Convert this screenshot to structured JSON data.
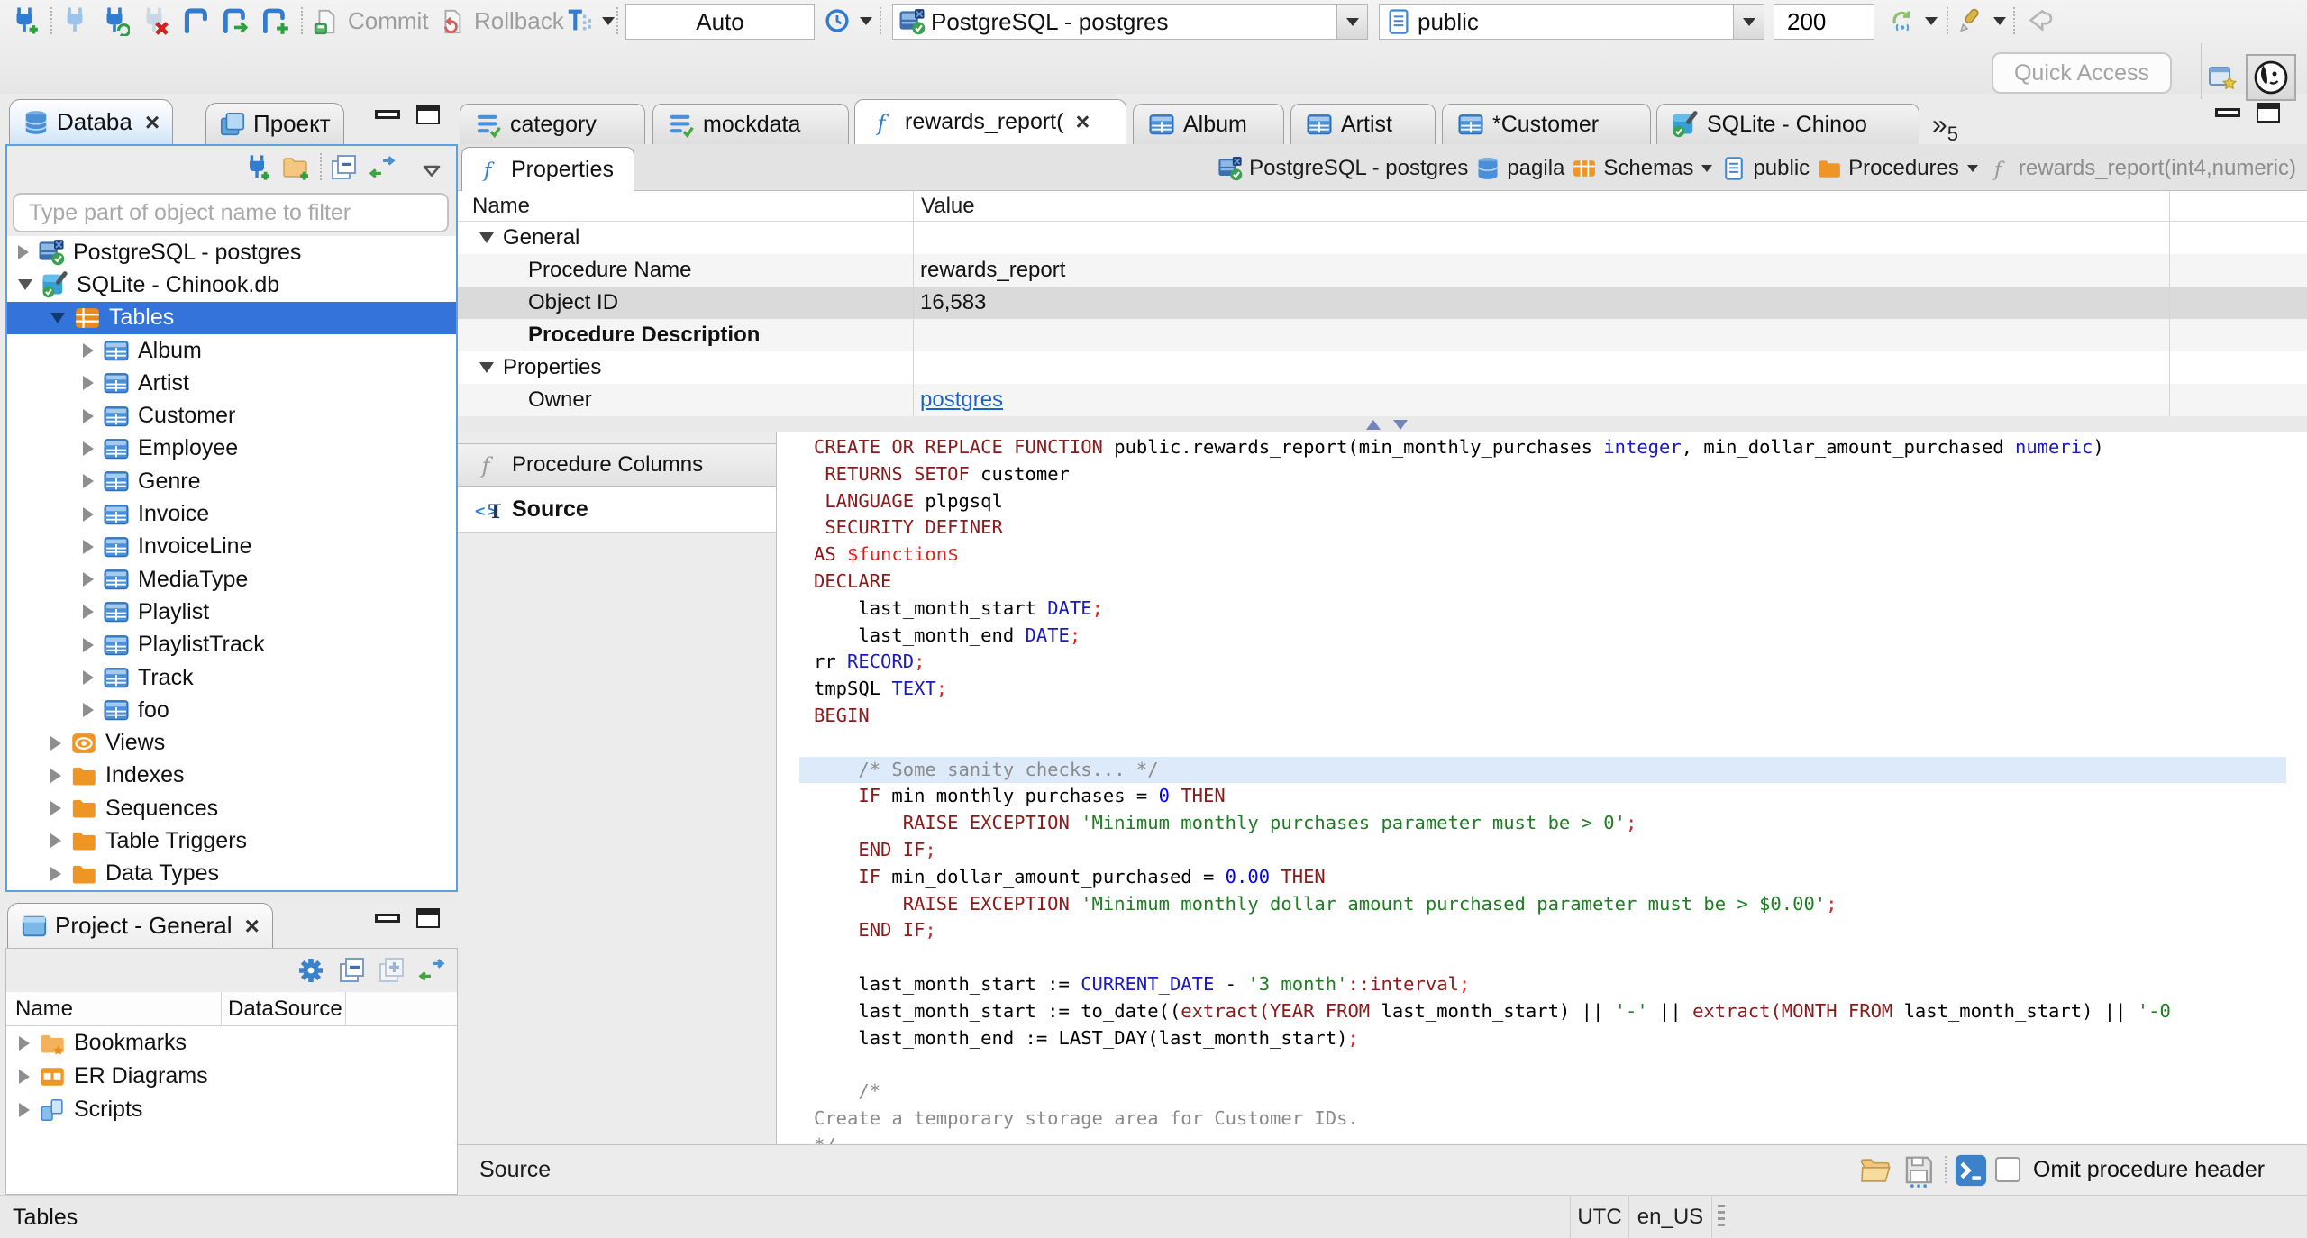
{
  "main_toolbar": {
    "commit": "Commit",
    "rollback": "Rollback",
    "tx_mode": "Auto",
    "connection": "PostgreSQL - postgres",
    "schema": "public",
    "fetch_size": "200",
    "quick_access": "Quick Access"
  },
  "navigator": {
    "tab_database": "Databa",
    "tab_project": "Проект",
    "filter_placeholder": "Type part of object name to filter",
    "tree": [
      {
        "label": "PostgreSQL - postgres",
        "icon": "postgres-db",
        "level": 0,
        "state": "collapsed"
      },
      {
        "label": "SQLite - Chinook.db",
        "icon": "sqlite-db",
        "level": 0,
        "state": "expanded"
      },
      {
        "label": "Tables",
        "icon": "tables",
        "level": 1,
        "state": "expanded",
        "selected": true
      },
      {
        "label": "Album",
        "icon": "table",
        "level": 2,
        "state": "collapsed"
      },
      {
        "label": "Artist",
        "icon": "table",
        "level": 2,
        "state": "collapsed"
      },
      {
        "label": "Customer",
        "icon": "table",
        "level": 2,
        "state": "collapsed"
      },
      {
        "label": "Employee",
        "icon": "table",
        "level": 2,
        "state": "collapsed"
      },
      {
        "label": "Genre",
        "icon": "table",
        "level": 2,
        "state": "collapsed"
      },
      {
        "label": "Invoice",
        "icon": "table",
        "level": 2,
        "state": "collapsed"
      },
      {
        "label": "InvoiceLine",
        "icon": "table",
        "level": 2,
        "state": "collapsed"
      },
      {
        "label": "MediaType",
        "icon": "table",
        "level": 2,
        "state": "collapsed"
      },
      {
        "label": "Playlist",
        "icon": "table",
        "level": 2,
        "state": "collapsed"
      },
      {
        "label": "PlaylistTrack",
        "icon": "table",
        "level": 2,
        "state": "collapsed"
      },
      {
        "label": "Track",
        "icon": "table",
        "level": 2,
        "state": "collapsed"
      },
      {
        "label": "foo",
        "icon": "table",
        "level": 2,
        "state": "collapsed"
      },
      {
        "label": "Views",
        "icon": "views",
        "level": 1,
        "state": "collapsed"
      },
      {
        "label": "Indexes",
        "icon": "folder",
        "level": 1,
        "state": "collapsed"
      },
      {
        "label": "Sequences",
        "icon": "folder",
        "level": 1,
        "state": "collapsed"
      },
      {
        "label": "Table Triggers",
        "icon": "folder",
        "level": 1,
        "state": "collapsed"
      },
      {
        "label": "Data Types",
        "icon": "folder",
        "level": 1,
        "state": "collapsed"
      }
    ]
  },
  "project_panel": {
    "title": "Project - General",
    "col_name": "Name",
    "col_datasource": "DataSource",
    "items": [
      {
        "label": "Bookmarks",
        "icon": "bookmarks"
      },
      {
        "label": "ER Diagrams",
        "icon": "er-diagrams"
      },
      {
        "label": "Scripts",
        "icon": "scripts"
      }
    ]
  },
  "editor": {
    "tabs": [
      {
        "label": "category",
        "icon": "sql-script"
      },
      {
        "label": "mockdata",
        "icon": "sql-script"
      },
      {
        "label": "rewards_report(",
        "icon": "function",
        "active": true,
        "closable": true
      },
      {
        "label": "Album",
        "icon": "table"
      },
      {
        "label": "Artist",
        "icon": "table"
      },
      {
        "label": "*Customer",
        "icon": "table"
      },
      {
        "label": "SQLite - Chinoo",
        "icon": "sqlite-db"
      }
    ],
    "overflow_chevron": "»",
    "overflow_count": "5",
    "properties_tab": "Properties",
    "breadcrumb": [
      {
        "label": "PostgreSQL - postgres",
        "icon": "postgres-db"
      },
      {
        "label": "pagila",
        "icon": "database"
      },
      {
        "label": "Schemas",
        "icon": "schemas",
        "dropdown": true
      },
      {
        "label": "public",
        "icon": "schema"
      },
      {
        "label": "Procedures",
        "icon": "folder",
        "dropdown": true
      },
      {
        "label": "rewards_report(int4,numeric)",
        "icon": "function-gray",
        "muted": true
      }
    ],
    "grid": {
      "col_name": "Name",
      "col_value": "Value",
      "rows": [
        {
          "name": "General",
          "kind": "group"
        },
        {
          "name": "Procedure Name",
          "kind": "item",
          "value": "rewards_report"
        },
        {
          "name": "Object ID",
          "kind": "item",
          "value": "16,583",
          "selected": true
        },
        {
          "name": "Procedure Description",
          "kind": "item",
          "value": "",
          "bold": true
        },
        {
          "name": "Properties",
          "kind": "group"
        },
        {
          "name": "Owner",
          "kind": "item",
          "value": "postgres",
          "link": true
        }
      ]
    },
    "side_tabs": [
      {
        "label": "Procedure Columns",
        "icon": "function-gray"
      },
      {
        "label": "Source",
        "icon": "source",
        "active": true
      }
    ],
    "bottom_bar": {
      "label": "Source",
      "omit_label": "Omit procedure header"
    }
  },
  "source_code": {
    "lines": [
      {
        "seg": [
          [
            "CREATE OR REPLACE FUNCTION",
            "k"
          ],
          [
            " public.rewards_report(min_monthly_purchases ",
            "p"
          ],
          [
            "integer",
            "t"
          ],
          [
            ", min_dollar_amount_purchased ",
            "p"
          ],
          [
            "numeric",
            "t"
          ],
          [
            ")",
            "p"
          ]
        ]
      },
      {
        "seg": [
          [
            " RETURNS SETOF",
            "k"
          ],
          [
            " customer",
            "p"
          ]
        ]
      },
      {
        "seg": [
          [
            " LANGUAGE",
            "k"
          ],
          [
            " plpgsql",
            "p"
          ]
        ]
      },
      {
        "seg": [
          [
            " SECURITY DEFINER",
            "k"
          ]
        ]
      },
      {
        "seg": [
          [
            "AS",
            "k"
          ],
          [
            " ",
            "p"
          ],
          [
            "$function$",
            "r"
          ]
        ]
      },
      {
        "seg": [
          [
            "DECLARE",
            "k"
          ]
        ]
      },
      {
        "seg": [
          [
            "    last_month_start ",
            "p"
          ],
          [
            "DATE",
            "t"
          ],
          [
            ";",
            "r"
          ]
        ]
      },
      {
        "seg": [
          [
            "    last_month_end ",
            "p"
          ],
          [
            "DATE",
            "t"
          ],
          [
            ";",
            "r"
          ]
        ]
      },
      {
        "seg": [
          [
            "rr ",
            "p"
          ],
          [
            "RECORD",
            "t"
          ],
          [
            ";",
            "r"
          ]
        ]
      },
      {
        "seg": [
          [
            "tmpSQL ",
            "p"
          ],
          [
            "TEXT",
            "t"
          ],
          [
            ";",
            "r"
          ]
        ]
      },
      {
        "seg": [
          [
            "BEGIN",
            "k"
          ]
        ]
      },
      {
        "seg": []
      },
      {
        "hl": true,
        "seg": [
          [
            "    /* Some sanity checks... */",
            "c"
          ]
        ]
      },
      {
        "seg": [
          [
            "    IF",
            "k"
          ],
          [
            " min_monthly_purchases = ",
            "p"
          ],
          [
            "0",
            "n"
          ],
          [
            " ",
            "p"
          ],
          [
            "THEN",
            "k"
          ]
        ]
      },
      {
        "seg": [
          [
            "        RAISE EXCEPTION",
            "k"
          ],
          [
            " ",
            "p"
          ],
          [
            "'Minimum monthly purchases parameter must be > 0'",
            "s"
          ],
          [
            ";",
            "r"
          ]
        ]
      },
      {
        "seg": [
          [
            "    END IF",
            "k"
          ],
          [
            ";",
            "r"
          ]
        ]
      },
      {
        "seg": [
          [
            "    IF",
            "k"
          ],
          [
            " min_dollar_amount_purchased = ",
            "p"
          ],
          [
            "0.00",
            "n"
          ],
          [
            " ",
            "p"
          ],
          [
            "THEN",
            "k"
          ]
        ]
      },
      {
        "seg": [
          [
            "        RAISE EXCEPTION",
            "k"
          ],
          [
            " ",
            "p"
          ],
          [
            "'Minimum monthly dollar amount purchased parameter must be > $0.00'",
            "s"
          ],
          [
            ";",
            "r"
          ]
        ]
      },
      {
        "seg": [
          [
            "    END IF",
            "k"
          ],
          [
            ";",
            "r"
          ]
        ]
      },
      {
        "seg": []
      },
      {
        "seg": [
          [
            "    last_month_start := ",
            "p"
          ],
          [
            "CURRENT_DATE",
            "t"
          ],
          [
            " - ",
            "p"
          ],
          [
            "'3 month'",
            "s"
          ],
          [
            "::interval",
            "k"
          ],
          [
            ";",
            "r"
          ]
        ]
      },
      {
        "seg": [
          [
            "    last_month_start := to_date((",
            "p"
          ],
          [
            "extract(",
            "k"
          ],
          [
            "YEAR FROM",
            "k"
          ],
          [
            " last_month_start) || ",
            "p"
          ],
          [
            "'-'",
            "s"
          ],
          [
            " || ",
            "p"
          ],
          [
            "extract(",
            "k"
          ],
          [
            "MONTH FROM",
            "k"
          ],
          [
            " last_month_start) || ",
            "p"
          ],
          [
            "'-0",
            "s"
          ]
        ]
      },
      {
        "seg": [
          [
            "    last_month_end := LAST_DAY(last_month_start)",
            "p"
          ],
          [
            ";",
            "r"
          ]
        ]
      },
      {
        "seg": []
      },
      {
        "seg": [
          [
            "    /*",
            "c"
          ]
        ]
      },
      {
        "seg": [
          [
            "Create a temporary storage area for Customer IDs.",
            "c"
          ]
        ]
      },
      {
        "seg": [
          [
            "*/",
            "c"
          ]
        ]
      }
    ]
  },
  "statusbar": {
    "context": "Tables",
    "timezone": "UTC",
    "locale": "en_US"
  },
  "colors": {
    "selection": "#3473d9",
    "keyword": "#8b1a1a",
    "string": "#1e7d22",
    "number": "#0000ff",
    "datatype": "#1a1ac0",
    "comment": "#8a8a8a",
    "error_red": "#e01e1e",
    "link": "#1b64c4"
  }
}
